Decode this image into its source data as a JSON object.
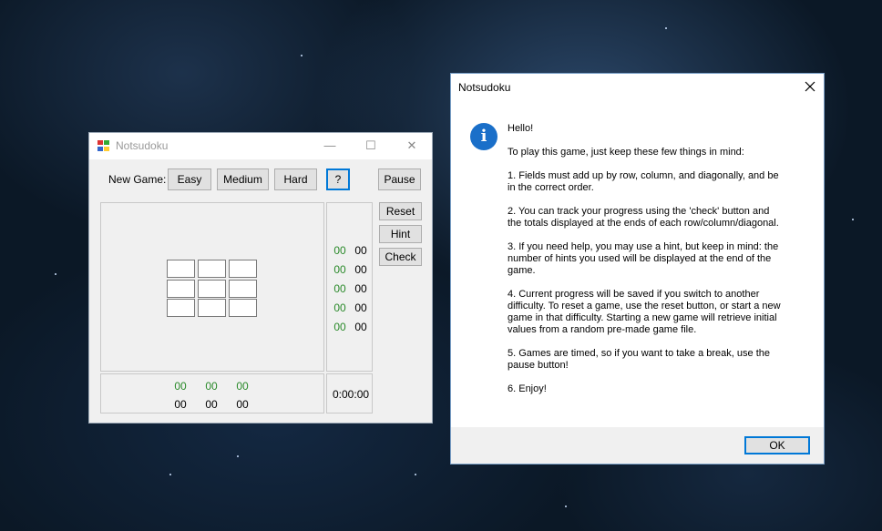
{
  "main_window": {
    "title": "Notsudoku",
    "controls": {
      "minimize": "—",
      "maximize": "☐",
      "close": "✕"
    },
    "new_game_label": "New Game:",
    "buttons": {
      "easy": "Easy",
      "medium": "Medium",
      "hard": "Hard",
      "help": "?",
      "pause": "Pause",
      "reset": "Reset",
      "hint": "Hint",
      "check": "Check"
    },
    "row_totals": [
      {
        "current": "00",
        "target": "00"
      },
      {
        "current": "00",
        "target": "00"
      },
      {
        "current": "00",
        "target": "00"
      },
      {
        "current": "00",
        "target": "00"
      },
      {
        "current": "00",
        "target": "00"
      }
    ],
    "column_totals_current": [
      "00",
      "00",
      "00"
    ],
    "column_totals_target": [
      "00",
      "00",
      "00"
    ],
    "timer": "0:00:00",
    "colors": {
      "current_total": "#2a8a2a",
      "focus": "#0078d7"
    }
  },
  "dialog": {
    "title": "Notsudoku",
    "icon": "info-icon",
    "greeting": "Hello!",
    "intro": "To play this game, just keep these few things in mind:",
    "rules": [
      "1. Fields must add up by row, column, and diagonally, and be\nin the correct order.",
      "2. You can track your progress using the 'check' button and\nthe totals displayed at the ends of each row/column/diagonal.",
      "3. If you need help, you may use a hint, but keep in mind: the\nnumber of hints you used will be displayed at the end of the\ngame.",
      "4. Current progress will be saved if you switch to another\ndifficulty. To reset a game, use the reset button, or start a new\ngame in that difficulty. Starting a new game will retrieve initial\nvalues from a random pre-made game file.",
      "5. Games are timed, so if you want to take a break, use the\npause button!",
      "6. Enjoy!"
    ],
    "ok_label": "OK"
  }
}
